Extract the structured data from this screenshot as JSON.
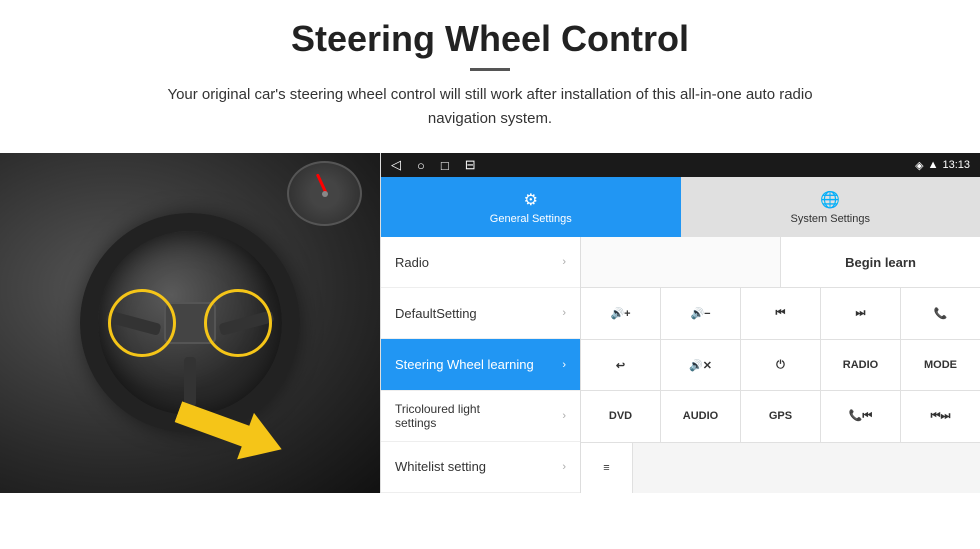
{
  "header": {
    "title": "Steering Wheel Control",
    "subtitle": "Your original car's steering wheel control will still work after installation of this all-in-one auto radio navigation system."
  },
  "android": {
    "statusBar": {
      "navBack": "◁",
      "navHome": "○",
      "navRecent": "□",
      "navMenu": "⊟",
      "time": "13:13",
      "icons": [
        "♥",
        "▲"
      ]
    },
    "tabs": [
      {
        "id": "general",
        "label": "General Settings",
        "active": true
      },
      {
        "id": "system",
        "label": "System Settings",
        "active": false
      }
    ],
    "menuItems": [
      {
        "id": "radio",
        "label": "Radio",
        "active": false
      },
      {
        "id": "default",
        "label": "DefaultSetting",
        "active": false
      },
      {
        "id": "steering",
        "label": "Steering Wheel learning",
        "active": true
      },
      {
        "id": "tricoloured",
        "label": "Tricoloured light settings",
        "active": false
      },
      {
        "id": "whitelist",
        "label": "Whitelist setting",
        "active": false
      }
    ],
    "buttons": {
      "beginLearn": "Begin learn",
      "row2": [
        "vol+",
        "vol-",
        "prev",
        "next",
        "phone"
      ],
      "row3": [
        "back",
        "mute",
        "power",
        "RADIO",
        "MODE"
      ],
      "row4": [
        "DVD",
        "AUDIO",
        "GPS",
        "phone+prev",
        "prev+next"
      ],
      "row5": [
        "list-icon"
      ]
    }
  }
}
